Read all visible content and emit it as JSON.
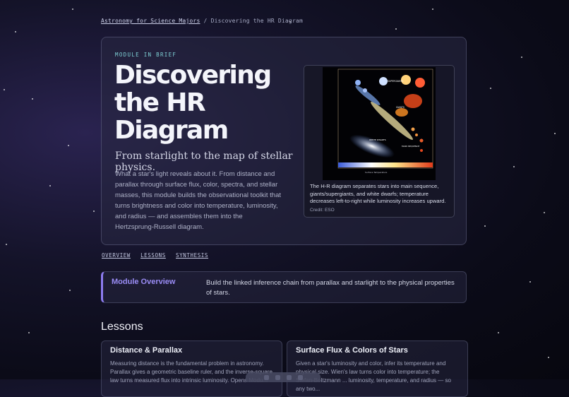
{
  "breadcrumb": {
    "course_link": "Astronomy for Science Majors",
    "separator": "/",
    "current": "Discovering the HR Diagram"
  },
  "hero": {
    "kicker": "MODULE IN BRIEF",
    "title": "Discovering the HR Diagram",
    "subtitle": "From starlight to the map of stellar physics.",
    "lede": "What a star's light reveals about it. From distance and parallax through surface flux, color, spectra, and stellar masses, this module builds the observational toolkit that turns brightness and color into temperature, luminosity, and radius — and assembles them into the Hertzsprung-Russell diagram.",
    "figure": {
      "caption": "The H-R diagram separates stars into main sequence, giants/supergiants, and white dwarfs; temperature decreases left-to-right while luminosity increases upward.",
      "credit": "Credit: ESO",
      "image_description": "ESO Hertzsprung-Russell diagram image"
    }
  },
  "subnav": [
    "OVERVIEW",
    "LESSONS",
    "SYNTHESIS"
  ],
  "overview": {
    "label": "Module Overview",
    "text": "Build the linked inference chain from parallax and starlight to the physical properties of stars."
  },
  "lessons": {
    "heading": "Lessons",
    "cards": [
      {
        "title": "Distance & Parallax",
        "text": "Measuring distance is the fundamental problem in astronomy. Parallax gives a geometric baseline ruler, and the inverse-square law turns measured flux into intrinsic luminosity. Opens Modu..."
      },
      {
        "title": "Surface Flux & Colors of Stars",
        "text": "Given a star's luminosity and color, infer its temperature and physical size. Wien's law turns color into temperature; the Stefan-Boltzmann ... luminosity, temperature, and radius — so any two..."
      }
    ]
  },
  "colors": {
    "accent": "#8d7cf0",
    "kicker": "#7fd1d6",
    "background": "#0b0b18"
  }
}
